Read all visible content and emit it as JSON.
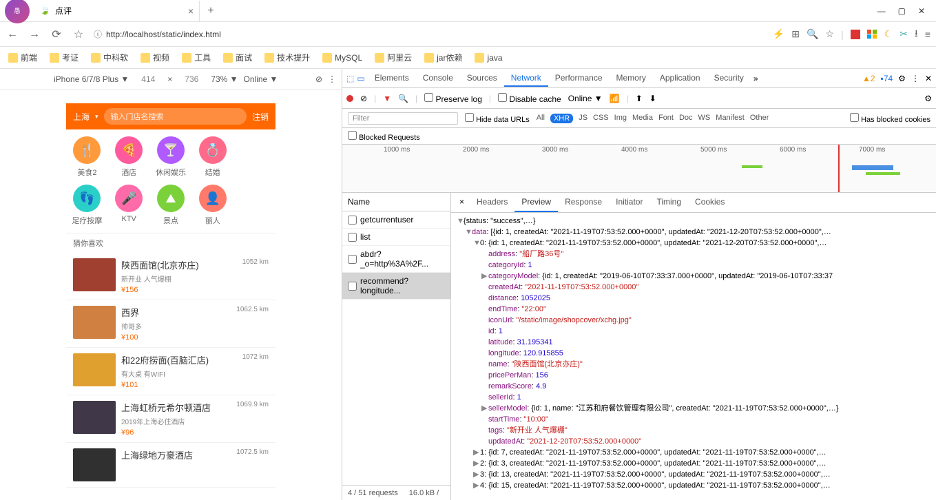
{
  "browser": {
    "tab_title": "点评",
    "url_display": "http://localhost/static/index.html",
    "bookmarks": [
      "前端",
      "考证",
      "中科软",
      "视频",
      "工具",
      "面试",
      "技术提升",
      "MySQL",
      "阿里云",
      "jar依赖",
      "java"
    ]
  },
  "device_bar": {
    "device": "iPhone 6/7/8 Plus ▼",
    "width": "414",
    "height": "736",
    "zoom": "73% ▼",
    "throttle": "Online ▼"
  },
  "phone": {
    "city": "上海",
    "search_placeholder": "输入门店名搜索",
    "right_link": "注销",
    "categories": [
      {
        "label": "美食2",
        "color": "#ff9a3c",
        "icon": "🍴"
      },
      {
        "label": "酒店",
        "color": "#ff5a9e",
        "icon": "🍕"
      },
      {
        "label": "休闲娱乐",
        "color": "#b05aff",
        "icon": "🍸"
      },
      {
        "label": "结婚",
        "color": "#ff6a8a",
        "icon": "💍"
      },
      {
        "label": "",
        "color": "",
        "icon": ""
      },
      {
        "label": "足疗按摩",
        "color": "#2ad0c8",
        "icon": "👣"
      },
      {
        "label": "KTV",
        "color": "#ff6aa8",
        "icon": "🎤"
      },
      {
        "label": "景点",
        "color": "#7bd13a",
        "icon": "⛰"
      },
      {
        "label": "丽人",
        "color": "#ff7a6a",
        "icon": "👤"
      },
      {
        "label": "",
        "color": "",
        "icon": ""
      }
    ],
    "section_title": "猜你喜欢",
    "shops": [
      {
        "name": "陕西面馆(北京亦庄)",
        "tags": "新开业 人气爆棚",
        "price": "¥156",
        "dist": "1052 km",
        "img": "#a04030"
      },
      {
        "name": "西界",
        "tags": "帅哥多",
        "price": "¥100",
        "dist": "1062.5 km",
        "img": "#d08040"
      },
      {
        "name": "和22府捞面(百脑汇店)",
        "tags": "有大桌 有WIFI",
        "price": "¥101",
        "dist": "1072 km",
        "img": "#e0a030"
      },
      {
        "name": "上海虹桥元希尔顿酒店",
        "tags": "2019年上海必住酒店",
        "price": "¥96",
        "dist": "1069.9 km",
        "img": "#403848"
      },
      {
        "name": "上海绿地万豪酒店",
        "tags": "",
        "price": "",
        "dist": "1072.5 km",
        "img": "#303030"
      }
    ]
  },
  "devtools": {
    "tabs": [
      "Elements",
      "Console",
      "Sources",
      "Network",
      "Performance",
      "Memory",
      "Application",
      "Security"
    ],
    "active_tab": "Network",
    "warn_count": "2",
    "info_count": "74",
    "filter_row": {
      "preserve": "Preserve log",
      "disable": "Disable cache",
      "online": "Online"
    },
    "filter_placeholder": "Filter",
    "hide_data": "Hide data URLs",
    "types": [
      "All",
      "XHR",
      "JS",
      "CSS",
      "Img",
      "Media",
      "Font",
      "Doc",
      "WS",
      "Manifest",
      "Other"
    ],
    "active_type": "XHR",
    "blocked_cookies": "Has blocked cookies",
    "blocked_label": "Blocked Requests",
    "waterfall_ticks": [
      "1000 ms",
      "2000 ms",
      "3000 ms",
      "4000 ms",
      "5000 ms",
      "6000 ms",
      "7000 ms"
    ],
    "name_header": "Name",
    "requests": [
      "getcurrentuser",
      "list",
      "abdr?_o=http%3A%2F...",
      "recommend?longitude..."
    ],
    "selected_request": 3,
    "detail_tabs": [
      "Headers",
      "Preview",
      "Response",
      "Initiator",
      "Timing",
      "Cookies"
    ],
    "active_detail": "Preview",
    "status_left": "4 / 51 requests",
    "status_right": "16.0 kB /"
  },
  "json_preview": {
    "root": "{status: \"success\",…}",
    "data_line": "data: [{id: 1, createdAt: \"2021-11-19T07:53:52.000+0000\", updatedAt: \"2021-12-20T07:53:52.000+0000\",…",
    "item0_line": "0: {id: 1, createdAt: \"2021-11-19T07:53:52.000+0000\", updatedAt: \"2021-12-20T07:53:52.000+0000\",…",
    "fields": {
      "address": "\"船厂路36号\"",
      "categoryId": "1",
      "categoryModel": "{id: 1, createdAt: \"2019-06-10T07:33:37.000+0000\", updatedAt: \"2019-06-10T07:33:37",
      "createdAt": "\"2021-11-19T07:53:52.000+0000\"",
      "distance": "1052025",
      "endTime": "\"22:00\"",
      "iconUrl": "\"/static/image/shopcover/xchg.jpg\"",
      "id": "1",
      "latitude": "31.195341",
      "longitude": "120.915855",
      "name": "\"陕西面馆(北京亦庄)\"",
      "pricePerMan": "156",
      "remarkScore": "4.9",
      "sellerId": "1",
      "sellerModel": "{id: 1, name: \"江苏和府餐饮管理有限公司\", createdAt: \"2021-11-19T07:53:52.000+0000\",…}",
      "startTime": "\"10:00\"",
      "tags": "\"新开业 人气爆棚\"",
      "updatedAt": "\"2021-12-20T07:53:52.000+0000\""
    },
    "trailing": [
      "1: {id: 7, createdAt: \"2021-11-19T07:53:52.000+0000\", updatedAt: \"2021-11-19T07:53:52.000+0000\",…",
      "2: {id: 3, createdAt: \"2021-11-19T07:53:52.000+0000\", updatedAt: \"2021-11-19T07:53:52.000+0000\",…",
      "3: {id: 13, createdAt: \"2021-11-19T07:53:52.000+0000\", updatedAt: \"2021-11-19T07:53:52.000+0000\",…",
      "4: {id: 15, createdAt: \"2021-11-19T07:53:52.000+0000\", updatedAt: \"2021-11-19T07:53:52.000+0000\",…"
    ]
  }
}
